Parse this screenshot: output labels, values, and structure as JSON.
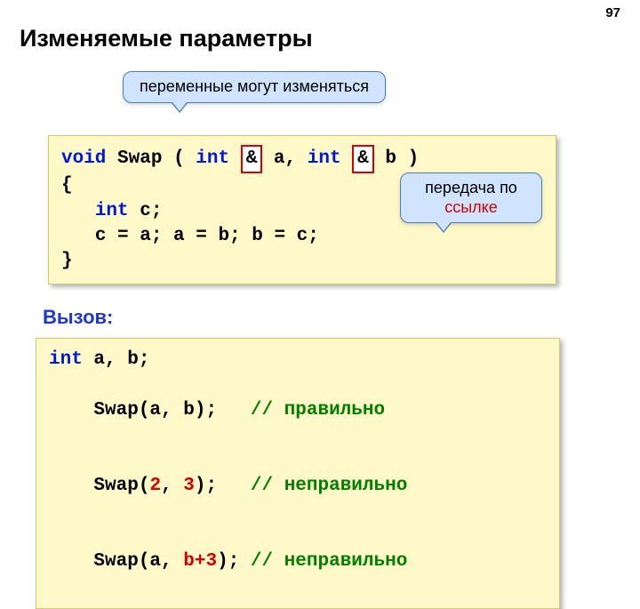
{
  "page": {
    "number": "97"
  },
  "title": "Изменяемые параметры",
  "callouts": {
    "vars_can_change": "переменные могут изменяться",
    "by_ref_line1": "передача по",
    "by_ref_line2": "ссылке"
  },
  "code1": {
    "l1_void": "void",
    "l1_swap": "Swap",
    "l1_open": " ( ",
    "l1_int": "int",
    "l1_amp": "&",
    "l1_space1": " ",
    "l1_a": "a, ",
    "l1_space2": " ",
    "l1_b": "b )",
    "l2": "{",
    "l3_indent": "  ",
    "l3_int": "int",
    "l3_c": " c;",
    "l4_indent": "  ",
    "l4_body": "c = a; a = b; b = c;",
    "l5": "}"
  },
  "subhead": "Вызов:",
  "code2": {
    "l1_int": "int",
    "l1_rest": " a, b;",
    "l2_a": "Swap(a, b);   ",
    "l2_c": "// правильно",
    "l3_a": "Swap(",
    "l3_n1": "2",
    "l3_mid": ", ",
    "l3_n2": "3",
    "l3_b": ");   ",
    "l3_c": "// неправильно",
    "l4_a": "Swap(a, ",
    "l4_r": "b+3",
    "l4_b": "); ",
    "l4_c": "// неправильно"
  }
}
